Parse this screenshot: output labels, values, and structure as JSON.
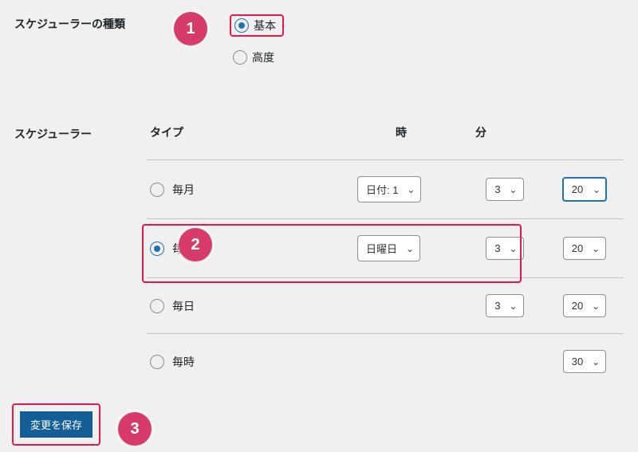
{
  "section1": {
    "label": "スケジューラーの種類",
    "options": {
      "basic": "基本",
      "advanced": "高度"
    }
  },
  "section2": {
    "label": "スケジューラー",
    "header": {
      "type": "タイプ",
      "hour": "時",
      "minute": "分"
    },
    "rows": {
      "monthly": {
        "label": "毎月",
        "param": "日付: 1",
        "hour": "3",
        "minute": "20"
      },
      "weekly": {
        "label": "毎週",
        "param": "日曜日",
        "hour": "3",
        "minute": "20"
      },
      "daily": {
        "label": "毎日",
        "hour": "3",
        "minute": "20"
      },
      "hourly": {
        "label": "毎時",
        "minute": "30"
      }
    }
  },
  "save": "変更を保存",
  "badges": {
    "b1": "1",
    "b2": "2",
    "b3": "3"
  }
}
